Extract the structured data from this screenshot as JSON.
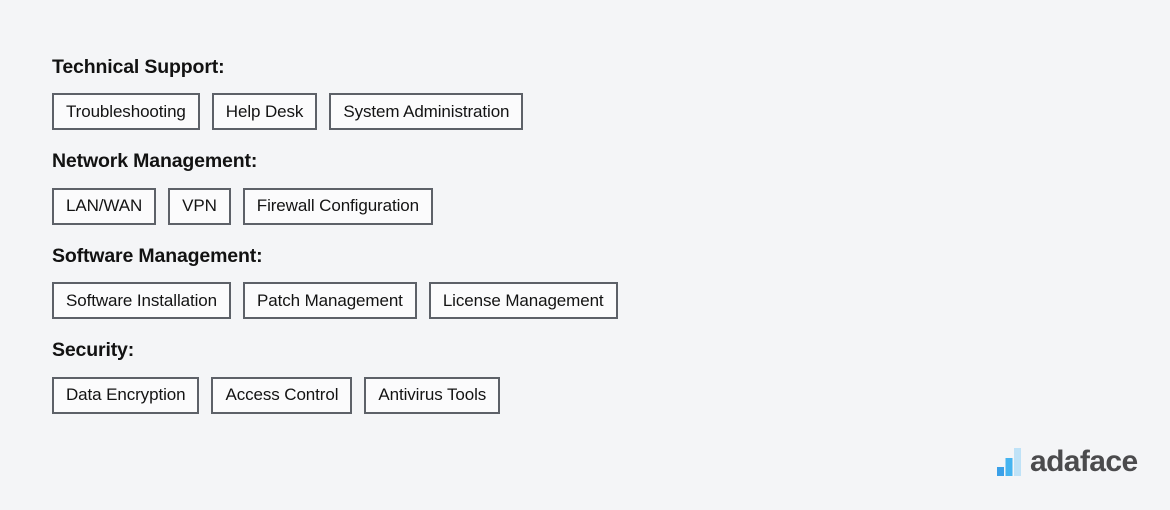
{
  "page": {
    "background_color": "#f4f5f7",
    "text_color": "#131313",
    "border_color": "#5d6168"
  },
  "groups": [
    {
      "heading": "Technical Support:",
      "chips": [
        "Troubleshooting",
        "Help Desk",
        "System Administration"
      ]
    },
    {
      "heading": "Network Management:",
      "chips": [
        "LAN/WAN",
        "VPN",
        "Firewall Configuration"
      ]
    },
    {
      "heading": "Software Management:",
      "chips": [
        "Software Installation",
        "Patch Management",
        "License Management"
      ]
    },
    {
      "heading": "Security:",
      "chips": [
        "Data Encryption",
        "Access Control",
        "Antivirus Tools"
      ]
    }
  ],
  "brand": {
    "wordmark": "adaface",
    "wordmark_color": "#4b4b4d",
    "mark_colors": {
      "bar_small": "#3aa0e8",
      "bar_medium": "#45b4f0",
      "bar_large": "#bfe2f7"
    }
  }
}
